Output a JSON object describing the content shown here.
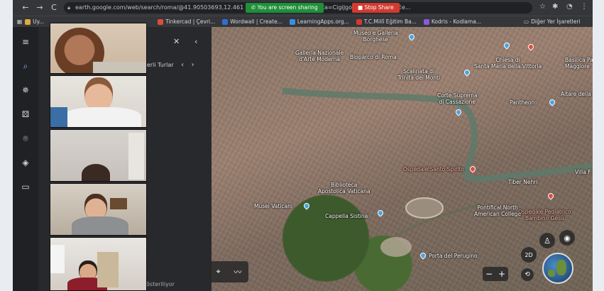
{
  "browser": {
    "url": "earth.google.com/web/search/roma/@41.90503693,12.461 ... 49h,59.99962611t,0r/data=CigiJgokCbGkqlapbUhAEe...",
    "share_notice": "You are screen sharing",
    "stop_share": "Stop Share",
    "nav": {
      "back": "←",
      "forward": "→",
      "reload": "C"
    }
  },
  "bookmarks": [
    {
      "label": "Uy...",
      "color": "#e2a93b"
    },
    {
      "label": "Tinkercad | Çevri...",
      "color": "#e14b3b"
    },
    {
      "label": "Wordwall | Create...",
      "color": "#2c6fd6"
    },
    {
      "label": "LearningApps.org...",
      "color": "#3a8ee6"
    },
    {
      "label": "T.C.Millî Eğitim Ba...",
      "color": "#d23a30"
    },
    {
      "label": "Kodris - Kodlama...",
      "color": "#8a5ad6"
    }
  ],
  "bookmarks_other": "Diğer Yer İşaretleri",
  "rail": [
    {
      "icon": "menu-icon",
      "glyph": "≡"
    },
    {
      "icon": "search-icon",
      "glyph": "⌕",
      "active": true
    },
    {
      "icon": "voyager-icon",
      "glyph": "✵"
    },
    {
      "icon": "dice-icon",
      "glyph": "⚄"
    },
    {
      "icon": "projects-icon",
      "glyph": "⌾"
    },
    {
      "icon": "layers-icon",
      "glyph": "◈"
    },
    {
      "icon": "measure-icon",
      "glyph": "▭"
    }
  ],
  "panel": {
    "close_glyph": "✕",
    "collapse_glyph": "‹",
    "tour_label": "mberli Turlar",
    "prev_glyph": "‹",
    "next_glyph": "›",
    "bottom_text": "österiliyor"
  },
  "map_labels": [
    {
      "text": "Museo e Galleria\nBorghese",
      "red": false
    },
    {
      "text": "Galleria Nazionale\nd'Arte Moderna",
      "red": false
    },
    {
      "text": "Bioparco di Roma",
      "red": false
    },
    {
      "text": "Chiesa di\nSanta Maria della Vittoria",
      "red": false
    },
    {
      "text": "Basilica Pa\nMaggiore",
      "red": false
    },
    {
      "text": "Scalinata di\nTrinità dei Monti",
      "red": false
    },
    {
      "text": "Corte Suprema\ndi Cassazione",
      "red": false
    },
    {
      "text": "Pantheon",
      "red": false
    },
    {
      "text": "Altare della",
      "red": false
    },
    {
      "text": "Ospedale Santo Spirito",
      "red": true
    },
    {
      "text": "Villa F",
      "red": false
    },
    {
      "text": "Tiber Nehri",
      "red": false
    },
    {
      "text": "Biblioteca\nApostolica Vaticana",
      "red": false
    },
    {
      "text": "Musei Vaticani",
      "red": false
    },
    {
      "text": "Cappella Sistina",
      "red": false
    },
    {
      "text": "Pontifical North\nAmerican College",
      "red": false
    },
    {
      "text": "Ospedale Pediatrico\nBambino Gesù",
      "red": true
    },
    {
      "text": "Porta del Perugino",
      "red": false
    }
  ],
  "controls": {
    "place_glyph": "⌖",
    "path_glyph": "〰",
    "zoom_out": "−",
    "zoom_in": "+",
    "mode_2d": "2D",
    "pegman_glyph": "♙",
    "compass_glyph": "◉",
    "orbit_glyph": "⟲"
  },
  "colors": {
    "browser_bar": "#35363a",
    "share_green": "#1f8f3a",
    "stop_red": "#d23a30",
    "panel": "#28292c",
    "rail": "#202124",
    "accent": "#8ab4f8"
  }
}
